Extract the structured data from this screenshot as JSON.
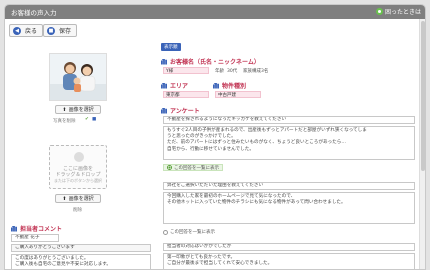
{
  "window": {
    "title": "お客様の声入力",
    "help_label": "困ったときは"
  },
  "toolbar": {
    "back_label": "戻る",
    "save_label": "保存"
  },
  "left": {
    "photo_button_label": "画像を選択",
    "photo_delete_label": "写真を削除",
    "dropzone_line1": "ここに画像を",
    "dropzone_line2": "ドラッグ＆ドロップ",
    "dropzone_hint": "または下のボタンから選択",
    "image_button_label": "画像を選択",
    "image_delete_label": "削除"
  },
  "comment": {
    "title": "担当者コメント",
    "staff_select": "不動産 花子",
    "line1": "ご購入ありがとうございます",
    "line2": "この度はありがとうございました。",
    "line3": "ご購入後も自宅のご意見や不安に対応します。"
  },
  "form": {
    "badge": "表示順",
    "customer_title": "お客様名（氏名・ニックネーム）",
    "customer_name": "Y様",
    "age_label": "年齢",
    "age_value": "30代",
    "household_label": "家族構成",
    "household_value": "3名",
    "area_title": "エリア",
    "area_value": "東京都",
    "type_title": "物件種別",
    "type_value": "中古戸建",
    "survey_title": "アンケート",
    "q1": "不動産を探されるようになったキッカケを教えてください",
    "a1_1": "もうすぐ2人目の子供が産まれるので、出産後もずっとアパートだと部屋がいずれ狭くなってしま",
    "a1_2": "うと思ったのがきっかけでした。",
    "a1_3": "ただ、前のアパートにはずっと住みたいものがなく、ちょうど良いところがあったら…",
    "a1_4": "自宅から、行動に移せていませんでした。",
    "radio_selected": "この回答を一覧に表示",
    "q2": "弊社をご選択いただいた理由を教えてください",
    "a2_1": "今回購入した家を最初のホームページで見て気になったので、",
    "a2_2": "その他ネットに入っていた物件のチラシにも気になる物件があって問い合わせました。",
    "radio_other": "この回答を一覧に表示",
    "q3": "担当者の対応はいかがでしたか",
    "a3_1": "第一印象がとても良かったです。",
    "a3_2": "ご自分が最後まで担当してくれて安心できました。"
  },
  "colors": {
    "accent": "#c03050",
    "blue": "#3a63b8",
    "green": "#5aa03a"
  },
  "icons": [
    "back-arrow-icon",
    "save-icon",
    "upload-icon",
    "help-icon",
    "chart-bar-icon"
  ]
}
